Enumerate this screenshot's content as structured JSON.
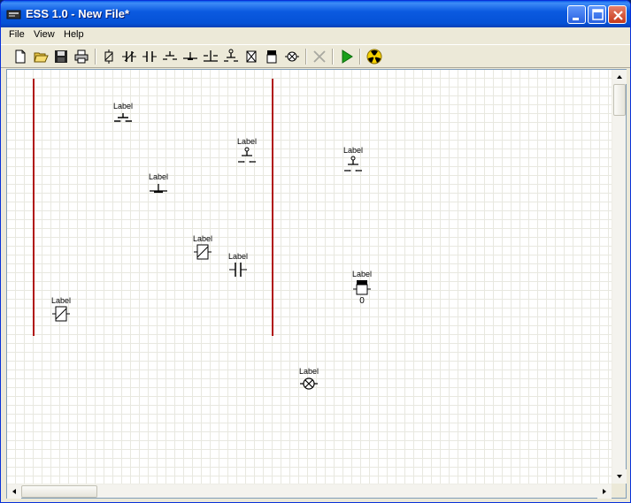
{
  "window": {
    "title": "ESS 1.0 - New File*"
  },
  "menu": {
    "file": "File",
    "view": "View",
    "help": "Help"
  },
  "toolbar": {
    "icons": [
      "new-file-icon",
      "open-folder-icon",
      "save-disk-icon",
      "print-icon",
      "coil-symbol-icon",
      "normally-closed-contact-icon",
      "normally-open-contact-icon",
      "pushbutton-open-icon",
      "pushbutton-closed-icon",
      "dual-pushbutton-icon",
      "limit-switch-icon",
      "timer-icon",
      "counter-icon",
      "lamp-icon",
      "delete-icon",
      "run-simulation-icon",
      "radiation-icon"
    ]
  },
  "canvas": {
    "components": [
      {
        "label": "Label",
        "type": "pushbutton-open"
      },
      {
        "label": "Label",
        "type": "limit-switch"
      },
      {
        "label": "Label",
        "type": "limit-switch"
      },
      {
        "label": "Label",
        "type": "pushbutton-closed"
      },
      {
        "label": "Label",
        "type": "coil"
      },
      {
        "label": "Label",
        "type": "normally-open-contact"
      },
      {
        "label": "Label",
        "type": "counter",
        "value": "0"
      },
      {
        "label": "Label",
        "type": "coil"
      },
      {
        "label": "Label",
        "type": "lamp"
      }
    ]
  },
  "colors": {
    "rail": "#b01414",
    "titlebar": "#0551d6",
    "run": "#1aa01a"
  }
}
